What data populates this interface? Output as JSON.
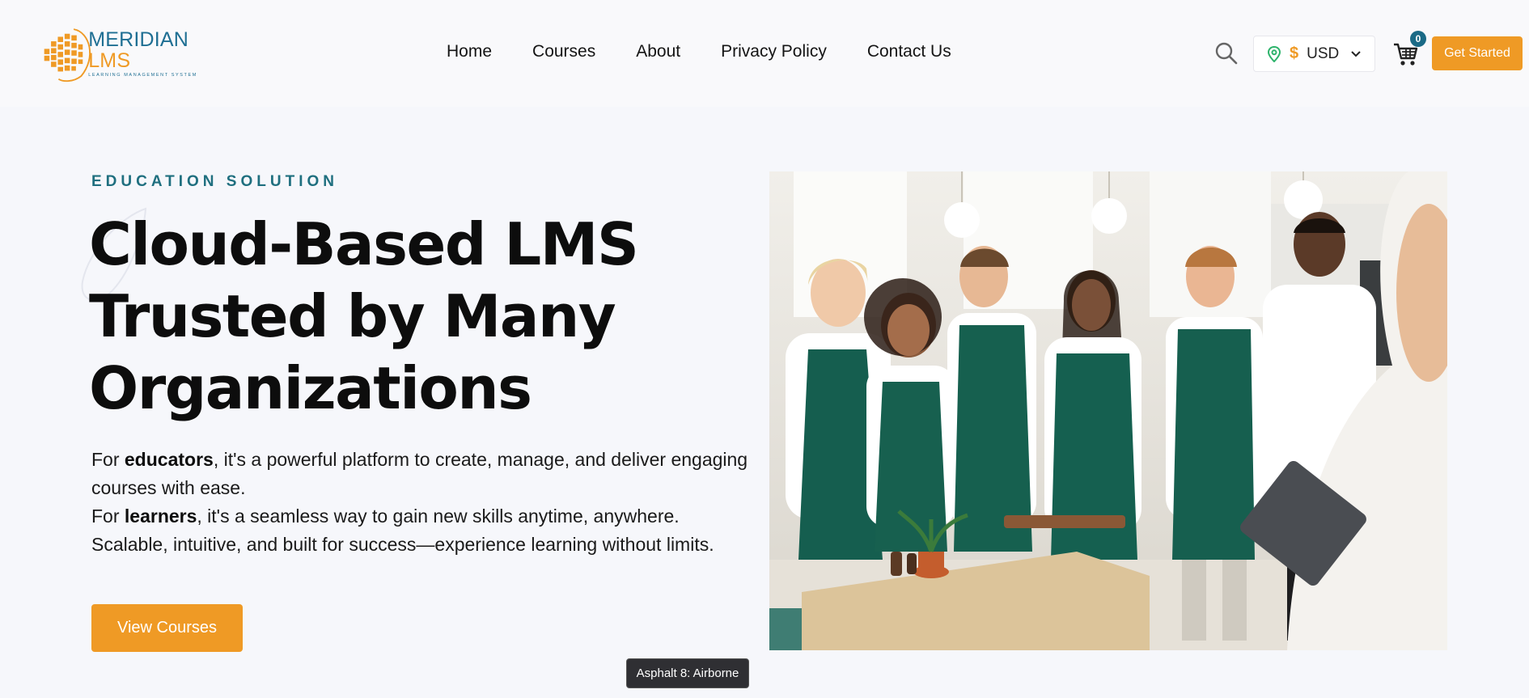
{
  "brand": {
    "name_part1": "MERIDIAN",
    "name_part2": "LMS",
    "tagline": "LEARNING MANAGEMENT SYSTEM",
    "colors": {
      "primary": "#1f6f93",
      "accent": "#ef9a25"
    }
  },
  "nav": {
    "items": [
      {
        "label": "Home"
      },
      {
        "label": "Courses"
      },
      {
        "label": "About"
      },
      {
        "label": "Privacy Policy"
      },
      {
        "label": "Contact Us"
      }
    ]
  },
  "toolbar": {
    "search_icon": "search-icon",
    "currency": {
      "location_icon": "map-pin-icon",
      "symbol": "$",
      "code": "USD",
      "chevron_icon": "chevron-down-icon"
    },
    "cart": {
      "icon": "cart-icon",
      "count": "0"
    },
    "cta_label": "Get Started"
  },
  "hero": {
    "eyebrow": "EDUCATION SOLUTION",
    "title_lines": [
      "Cloud-Based LMS",
      "Trusted by Many",
      "Organizations"
    ],
    "body": {
      "line1_pre": "For ",
      "line1_bold": "educators",
      "line1_post": ", it's a powerful platform to create, manage, and deliver engaging courses with ease.",
      "line2_pre": "For ",
      "line2_bold": "learners",
      "line2_post": ", it's a seamless way to gain new skills anytime, anywhere.",
      "line3": "Scalable, intuitive, and built for success—experience learning without limits."
    },
    "cta_label": "View Courses",
    "image": "photo-team-in-aprons"
  },
  "tooltip": {
    "text": "Asphalt 8: Airborne"
  }
}
